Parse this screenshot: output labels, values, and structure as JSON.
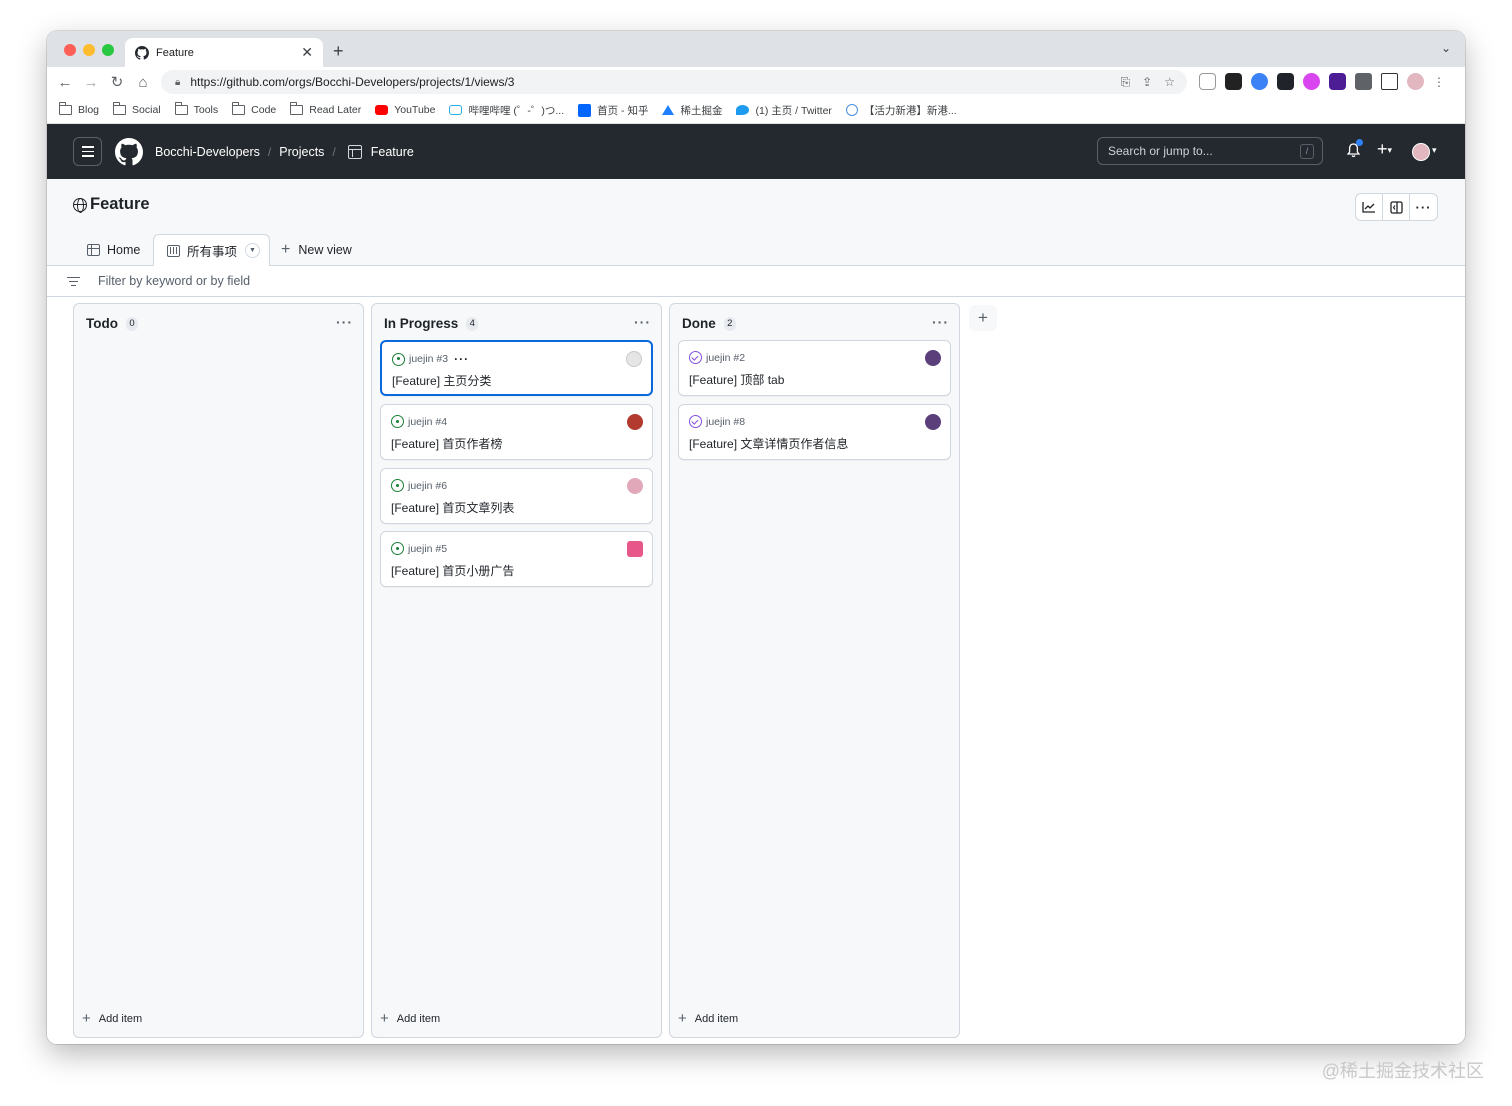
{
  "browser": {
    "tab_title": "Feature",
    "url": "https://github.com/orgs/Bocchi-Developers/projects/1/views/3",
    "bookmarks": [
      {
        "label": "Blog",
        "icon": "folder-icon"
      },
      {
        "label": "Social",
        "icon": "folder-icon"
      },
      {
        "label": "Tools",
        "icon": "folder-icon"
      },
      {
        "label": "Code",
        "icon": "folder-icon"
      },
      {
        "label": "Read Later",
        "icon": "folder-icon"
      },
      {
        "label": "YouTube",
        "icon": "youtube-icon"
      },
      {
        "label": "哔哩哔哩 (゜-゜)つ...",
        "icon": "bilibili-icon"
      },
      {
        "label": "首页 - 知乎",
        "icon": "zhihu-icon"
      },
      {
        "label": "稀土掘金",
        "icon": "juejin-icon"
      },
      {
        "label": "(1) 主页 / Twitter",
        "icon": "twitter-icon"
      },
      {
        "label": "【活力新港】新港...",
        "icon": "globe-icon"
      }
    ]
  },
  "github": {
    "org": "Bocchi-Developers",
    "projects": "Projects",
    "project_name": "Feature",
    "search_placeholder": "Search or jump to...",
    "search_key": "/"
  },
  "project": {
    "title": "Feature",
    "tabs": {
      "home": "Home",
      "active": "所有事项",
      "new_view": "New view"
    },
    "filter_placeholder": "Filter by keyword or by field"
  },
  "board": {
    "add_item_label": "Add item",
    "columns": [
      {
        "name": "Todo",
        "count": "0",
        "cards": []
      },
      {
        "name": "In Progress",
        "count": "4",
        "cards": [
          {
            "ref": "juejin #3",
            "title": "[Feature] 主页分类",
            "status": "open",
            "avatar_color": "#d9d9d9"
          },
          {
            "ref": "juejin #4",
            "title": "[Feature] 首页作者榜",
            "status": "open",
            "avatar_color": "#b23a2e"
          },
          {
            "ref": "juejin #6",
            "title": "[Feature] 首页文章列表",
            "status": "open",
            "avatar_color": "#e0a8b8"
          },
          {
            "ref": "juejin #5",
            "title": "[Feature] 首页小册广告",
            "status": "open",
            "avatar_color": "#e8578a"
          }
        ]
      },
      {
        "name": "Done",
        "count": "2",
        "cards": [
          {
            "ref": "juejin #2",
            "title": "[Feature] 顶部 tab",
            "status": "done",
            "avatar_color": "#5a3f7a"
          },
          {
            "ref": "juejin #8",
            "title": "[Feature] 文章详情页作者信息",
            "status": "done",
            "avatar_color": "#5a3f7a"
          }
        ]
      }
    ]
  },
  "watermark": "@稀土掘金技术社区"
}
